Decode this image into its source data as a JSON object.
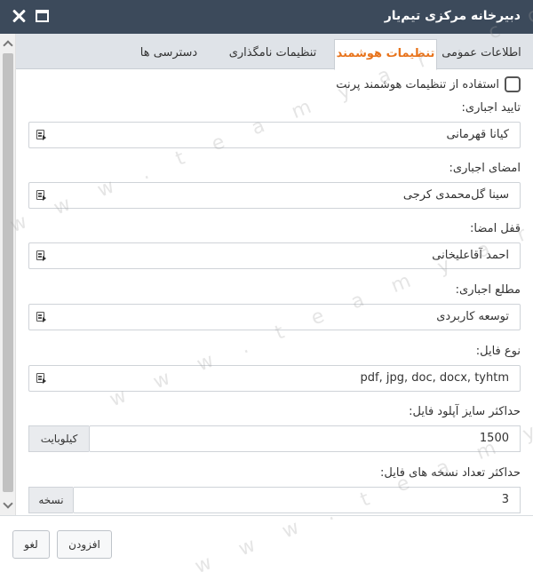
{
  "window": {
    "title": "دبیرخانه مرکزی تیم‌یار"
  },
  "tabs": [
    {
      "label": "اطلاعات عمومی"
    },
    {
      "label": "تنظیمات هوشمند"
    },
    {
      "label": "تنظیمات نامگذاری"
    },
    {
      "label": "دسترسی ها"
    }
  ],
  "smart": {
    "checkbox_label": "استفاده از تنظیمات هوشمند پرنت"
  },
  "fields": [
    {
      "label": "تایید اجباری:",
      "value": "کیانا قهرمانی"
    },
    {
      "label": "امضای اجباری:",
      "value": "سینا گل‌محمدی کرجی"
    },
    {
      "label": "قفل امضا:",
      "value": "احمد آقاعلیخانی"
    },
    {
      "label": "مطلع اجباری:",
      "value": "توسعه کاربردی"
    },
    {
      "label": "نوع فایل:",
      "value": "pdf, jpg, doc, docx, tyhtm"
    }
  ],
  "upload_size": {
    "label": "حداکثر سایز آپلود فایل:",
    "value": "1500",
    "unit": "کیلوبایت"
  },
  "copies": {
    "label": "حداکثر تعداد نسخه های فایل:",
    "value": "3",
    "unit": "نسخه"
  },
  "footer": {
    "add_label": "افزودن",
    "cancel_label": "لغو"
  },
  "watermark": "w w w . t e a m y a r . c o m",
  "colors": {
    "titlebar": "#3c4a5b",
    "active_tab": "#e8731b"
  }
}
